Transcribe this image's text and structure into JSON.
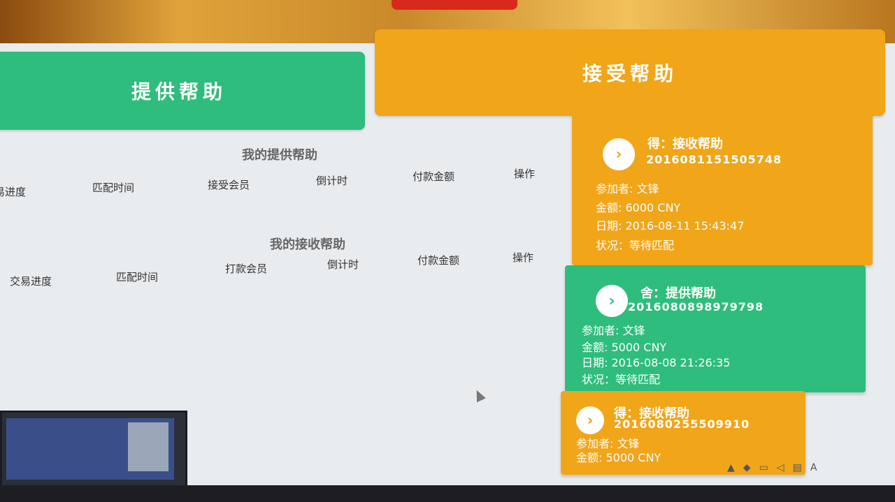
{
  "buttons": {
    "offer_help": "提供帮助",
    "receive_help": "接受帮助"
  },
  "offer_table": {
    "title": "我的提供帮助",
    "columns": [
      "易进度",
      "匹配时间",
      "接受会员",
      "倒计时",
      "付款金额",
      "操作"
    ]
  },
  "receive_table": {
    "title": "我的接收帮助",
    "columns": [
      "交易进度",
      "匹配时间",
      "打款会员",
      "倒计时",
      "付款金额",
      "操作"
    ]
  },
  "cards": [
    {
      "title": "得：接收帮助",
      "id": "2016081151505748",
      "participant": "参加者: 文锋",
      "amount": "金额: 6000 CNY",
      "date": "日期: 2016-08-11 15:43:47",
      "status": "状况：等待匹配"
    },
    {
      "title": "舍：提供帮助",
      "id": "2016080898979798",
      "participant": "参加者: 文锋",
      "amount": "金额: 5000 CNY",
      "date": "日期: 2016-08-08 21:26:35",
      "status": "状况：等待匹配"
    },
    {
      "title": "得：接收帮助",
      "id": "2016080255509910",
      "participant": "参加者: 文锋",
      "amount": "金额: 5000 CNY"
    }
  ],
  "tray": {
    "ime": "A"
  },
  "colors": {
    "green": "#2ebd7c",
    "orange": "#f1a519"
  }
}
